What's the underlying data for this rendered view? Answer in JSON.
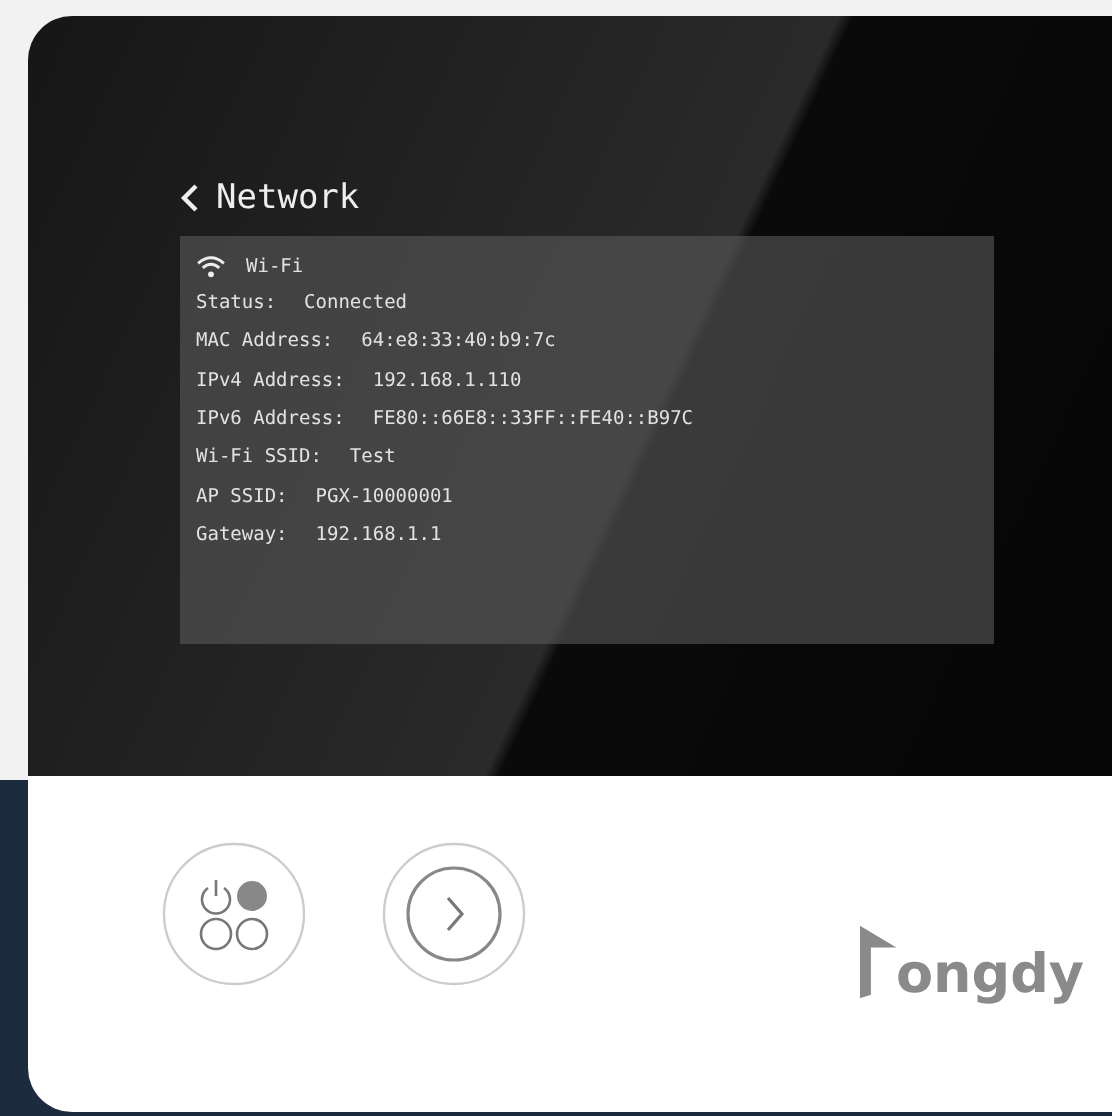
{
  "screen": {
    "title": "Network",
    "section": "Wi-Fi",
    "rows": [
      {
        "label": "Status:",
        "value": "Connected"
      },
      {
        "label": "MAC Address:",
        "value": "64:e8:33:40:b9:7c"
      },
      {
        "label": "IPv4 Address:",
        "value": "192.168.1.110"
      },
      {
        "label": "IPv6 Address:",
        "value": "FE80::66E8::33FF::FE40::B97C"
      },
      {
        "label": "Wi-Fi SSID:",
        "value": "Test"
      },
      {
        "label": "AP SSID:",
        "value": "PGX-10000001"
      },
      {
        "label": "Gateway:",
        "value": "192.168.1.1"
      }
    ]
  },
  "brand": "ongdy"
}
